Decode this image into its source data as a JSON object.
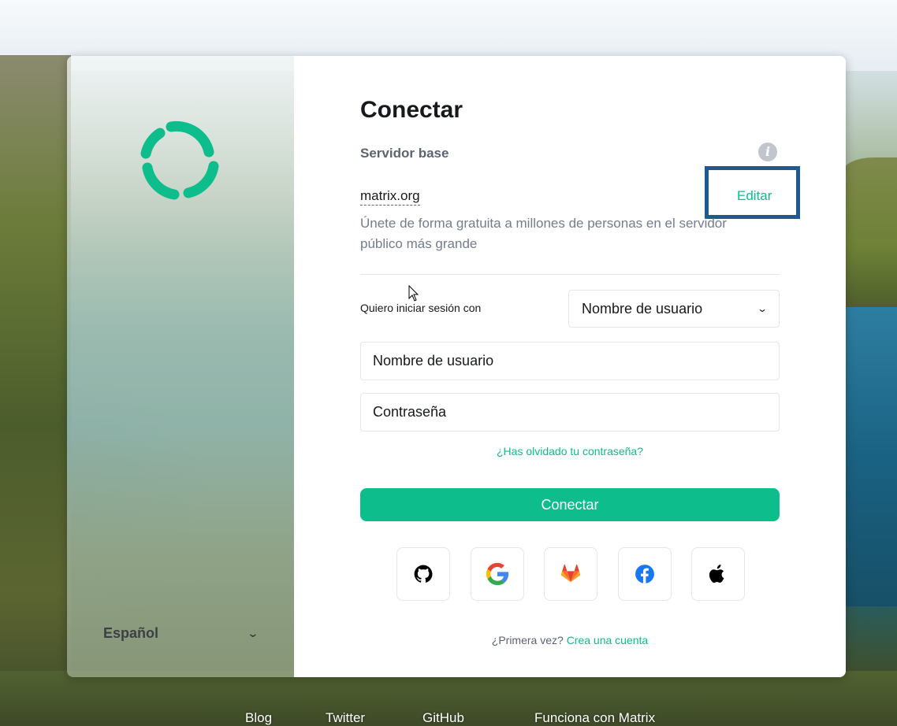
{
  "auth": {
    "title": "Conectar",
    "server_label": "Servidor base",
    "server_name": "matrix.org",
    "edit_label": "Editar",
    "server_description": "Únete de forma gratuita a millones de personas en el servidor público más grande",
    "login_with_label": "Quiero iniciar sesión con",
    "login_method_selected": "Nombre de usuario",
    "username_placeholder": "Nombre de usuario",
    "password_placeholder": "Contraseña",
    "forgot_password": "¿Has olvidado tu contraseña?",
    "submit_label": "Conectar",
    "sso_providers": [
      "github-icon",
      "google-icon",
      "gitlab-icon",
      "facebook-icon",
      "apple-icon"
    ],
    "signup_prompt": "¿Primera vez?",
    "signup_link": "Crea una cuenta"
  },
  "language": {
    "selected": "Español"
  },
  "footer": {
    "links": [
      "Blog",
      "Twitter",
      "GitHub",
      "Funciona con Matrix"
    ]
  },
  "colors": {
    "accent": "#0dbd8b",
    "highlight_border": "#1b5a95"
  }
}
